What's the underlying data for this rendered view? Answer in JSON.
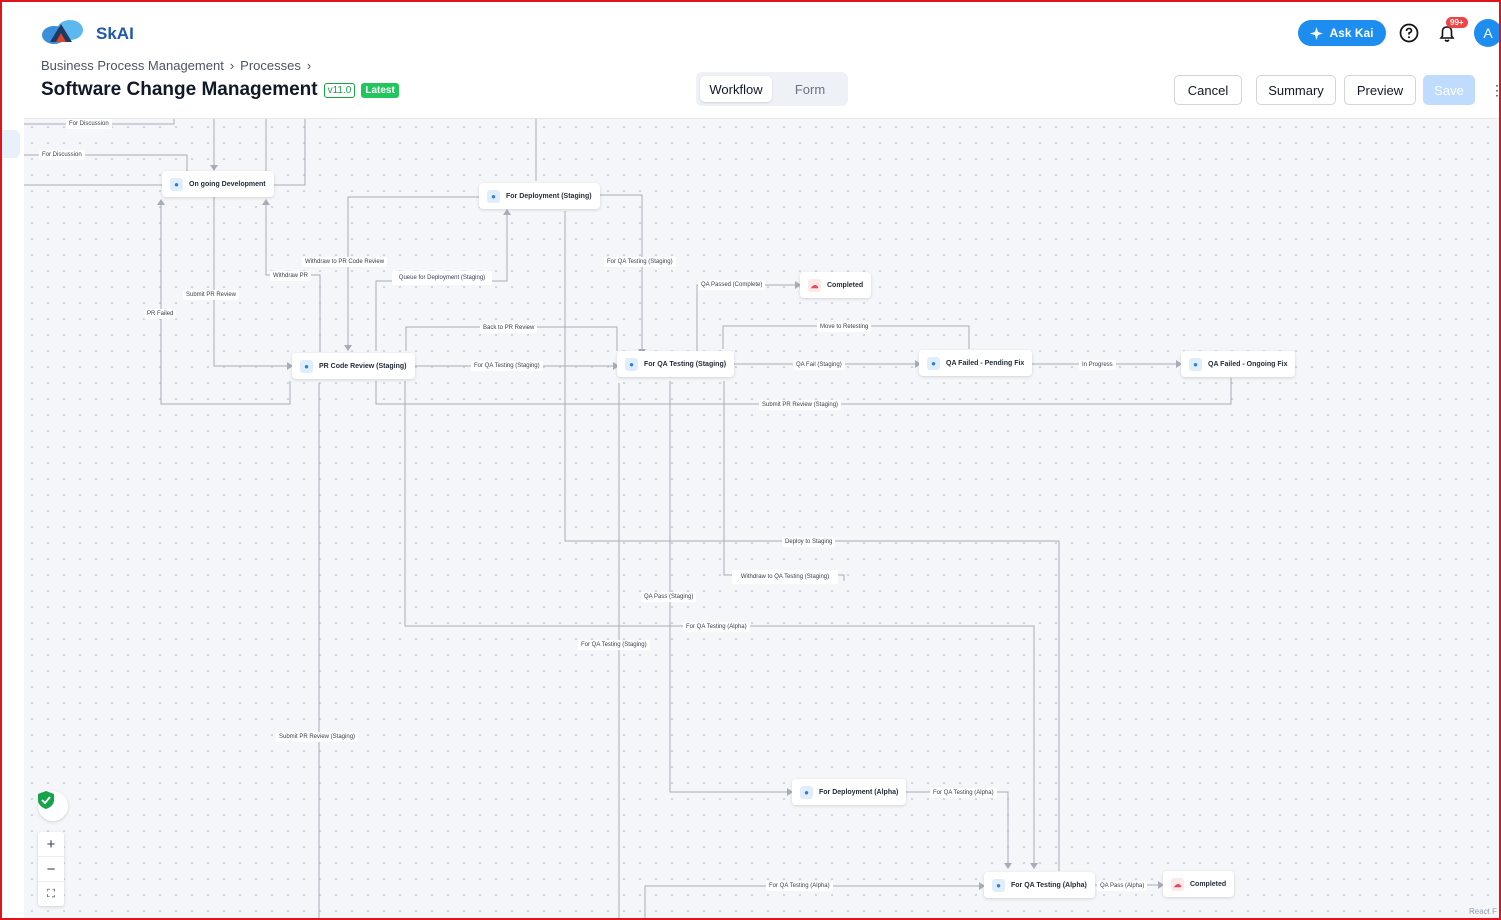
{
  "app": {
    "name": "SkAI"
  },
  "header": {
    "ask_kai": "Ask Kai",
    "notification_count": "99+",
    "avatar_initial": "A",
    "breadcrumb": [
      "Business Process Management",
      "Processes"
    ],
    "title": "Software Change Management",
    "version": "v11.0",
    "latest_badge": "Latest",
    "tabs": [
      "Workflow",
      "Form"
    ],
    "active_tab": "Workflow",
    "buttons": {
      "cancel": "Cancel",
      "summary": "Summary",
      "preview": "Preview",
      "save": "Save"
    }
  },
  "colors": {
    "accent": "#1d8df0",
    "brand": "#1e5aa8",
    "latest": "#22c55e",
    "save_disabled": "#bfdbfe",
    "shield": "#16a34a"
  },
  "icons": [
    "logo-icon",
    "sparkle-icon",
    "help-icon",
    "bell-icon",
    "user-icon",
    "cloud-icon",
    "shield-check-icon",
    "plus-icon",
    "minus-icon",
    "fit-view-icon",
    "more-vertical-icon",
    "chevron-right-icon"
  ],
  "workflow": {
    "nodes": [
      {
        "id": "ongoing_dev",
        "label": "On going Development"
      },
      {
        "id": "deploy_staging",
        "label": "For Deployment (Staging)"
      },
      {
        "id": "completed_1",
        "label": "Completed"
      },
      {
        "id": "pr_review",
        "label": "PR Code Review (Staging)"
      },
      {
        "id": "qa_staging",
        "label": "For QA Testing (Staging)"
      },
      {
        "id": "qa_failed_pending",
        "label": "QA Failed - Pending Fix"
      },
      {
        "id": "qa_failed_ongoing",
        "label": "QA Failed - Ongoing Fix"
      },
      {
        "id": "deploy_alpha",
        "label": "For Deployment (Alpha)"
      },
      {
        "id": "qa_alpha",
        "label": "For QA Testing (Alpha)"
      },
      {
        "id": "completed_2",
        "label": "Completed"
      }
    ],
    "edge_labels": [
      "For Discussion",
      "For Discussion",
      "Withdraw to PR Code Review",
      "Withdraw PR",
      "Queue for Deployment (Staging)",
      "Submit PR Review",
      "PR Failed",
      "For QA Testing (Staging)",
      "QA Passed (Complete)",
      "Back to PR Review",
      "Move to Retesting",
      "For QA Testing (Staging)",
      "QA Fail (Staging)",
      "In Progress",
      "Submit PR Review (Staging)",
      "Deploy to Staging",
      "Withdraw to QA Testing (Staging)",
      "QA Pass (Staging)",
      "For QA Testing (Alpha)",
      "For QA Testing (Staging)",
      "Submit PR Review (Staging)",
      "For QA Testing (Alpha)",
      "For QA Testing (Alpha)",
      "QA Pass (Alpha)"
    ]
  },
  "canvas": {
    "attribution": "React F"
  }
}
